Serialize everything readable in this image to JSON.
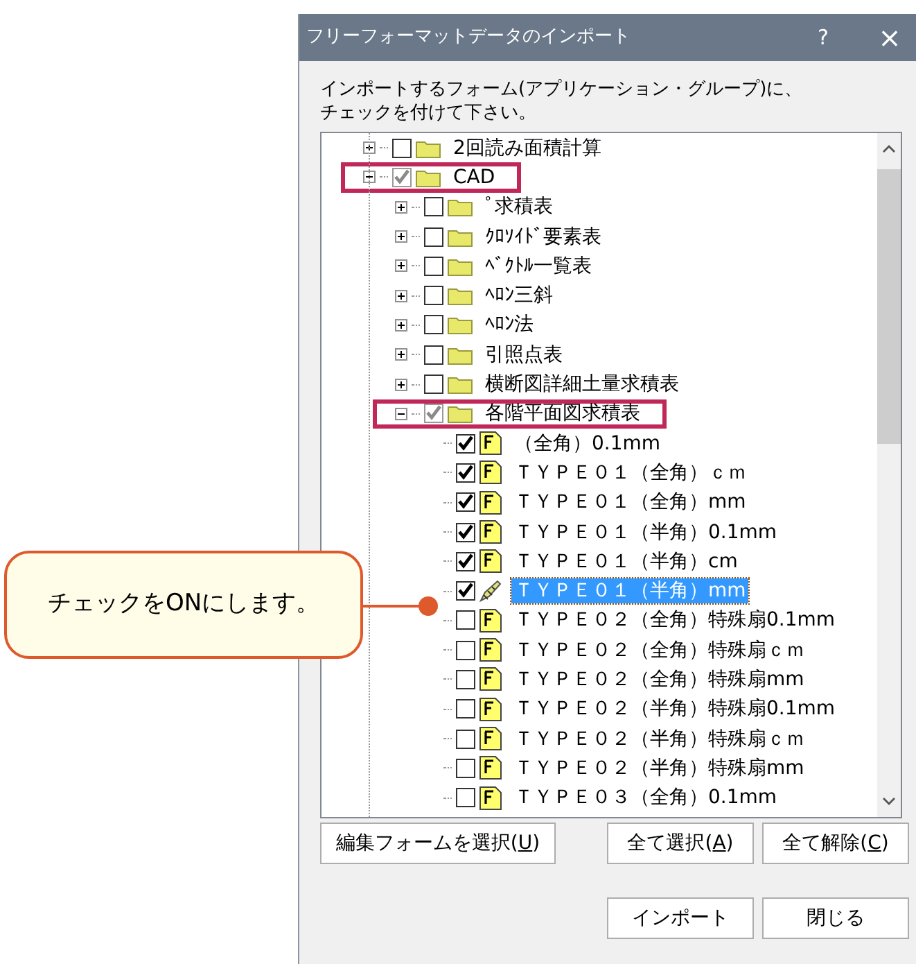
{
  "window": {
    "title": "フリーフォーマットデータのインポート",
    "help": "?",
    "close": "×"
  },
  "instruction": [
    "インポートするフォーム(アプリケーション・グループ)に、",
    "チェックを付けて下さい。"
  ],
  "tree": [
    {
      "kind": "folder",
      "label": "2回読み面積計算",
      "checked": false,
      "greyed": false,
      "expanded": false,
      "selected": false
    },
    {
      "kind": "folder",
      "label": "CAD",
      "checked": true,
      "greyed": true,
      "expanded": true,
      "selected": false,
      "highlighted": true,
      "children": [
        {
          "kind": "folder",
          "label": "ﾟ求積表",
          "checked": false,
          "greyed": false,
          "expanded": false,
          "selected": false
        },
        {
          "kind": "folder",
          "label": "ｸﾛｿｲﾄﾞ要素表",
          "checked": false,
          "greyed": false,
          "expanded": false,
          "selected": false
        },
        {
          "kind": "folder",
          "label": "ﾍﾞｸﾄﾙ一覧表",
          "checked": false,
          "greyed": false,
          "expanded": false,
          "selected": false
        },
        {
          "kind": "folder",
          "label": "ﾍﾛﾝ三斜",
          "checked": false,
          "greyed": false,
          "expanded": false,
          "selected": false
        },
        {
          "kind": "folder",
          "label": "ﾍﾛﾝ法",
          "checked": false,
          "greyed": false,
          "expanded": false,
          "selected": false
        },
        {
          "kind": "folder",
          "label": "引照点表",
          "checked": false,
          "greyed": false,
          "expanded": false,
          "selected": false
        },
        {
          "kind": "folder",
          "label": "横断図詳細土量求積表",
          "checked": false,
          "greyed": false,
          "expanded": false,
          "selected": false
        },
        {
          "kind": "folder",
          "label": "各階平面図求積表",
          "checked": true,
          "greyed": true,
          "expanded": true,
          "selected": false,
          "highlighted": true,
          "children": [
            {
              "kind": "form",
              "label": "（全角）0.1mm",
              "checked": true,
              "greyed": false,
              "selected": false
            },
            {
              "kind": "form",
              "label": "ＴＹＰＥ０１（全角）ｃｍ",
              "checked": true,
              "greyed": false,
              "selected": false
            },
            {
              "kind": "form",
              "label": "ＴＹＰＥ０１（全角）mm",
              "checked": true,
              "greyed": false,
              "selected": false
            },
            {
              "kind": "form",
              "label": "ＴＹＰＥ０１（半角）0.1mm",
              "checked": true,
              "greyed": false,
              "selected": false
            },
            {
              "kind": "form",
              "label": "ＴＹＰＥ０１（半角）cm",
              "checked": true,
              "greyed": false,
              "selected": false
            },
            {
              "kind": "form",
              "label": "ＴＹＰＥ０１（半角）mm",
              "checked": true,
              "greyed": false,
              "selected": true
            },
            {
              "kind": "form",
              "label": "ＴＹＰＥ０２（全角）特殊扇0.1mm",
              "checked": false,
              "greyed": false,
              "selected": false
            },
            {
              "kind": "form",
              "label": "ＴＹＰＥ０２（全角）特殊扇ｃｍ",
              "checked": false,
              "greyed": false,
              "selected": false
            },
            {
              "kind": "form",
              "label": "ＴＹＰＥ０２（全角）特殊扇mm",
              "checked": false,
              "greyed": false,
              "selected": false
            },
            {
              "kind": "form",
              "label": "ＴＹＰＥ０２（半角）特殊扇0.1mm",
              "checked": false,
              "greyed": false,
              "selected": false
            },
            {
              "kind": "form",
              "label": "ＴＹＰＥ０２（半角）特殊扇ｃｍ",
              "checked": false,
              "greyed": false,
              "selected": false
            },
            {
              "kind": "form",
              "label": "ＴＹＰＥ０２（半角）特殊扇mm",
              "checked": false,
              "greyed": false,
              "selected": false
            },
            {
              "kind": "form",
              "label": "ＴＹＰＥ０３（全角）0.1mm",
              "checked": false,
              "greyed": false,
              "selected": false
            }
          ]
        }
      ]
    }
  ],
  "buttons_row1": [
    {
      "label": "編集フォームを選択(",
      "access_key": "U",
      "label_end": ")",
      "kind": "left"
    },
    {
      "label": "全て選択(",
      "access_key": "A",
      "label_end": ")",
      "kind": "right"
    },
    {
      "label": "全て解除(",
      "access_key": "C",
      "label_end": ")",
      "kind": "right"
    }
  ],
  "buttons_row2": [
    {
      "label": "インポート"
    },
    {
      "label": "閉じる"
    }
  ],
  "callout": {
    "text": "チェックをONにします。"
  }
}
